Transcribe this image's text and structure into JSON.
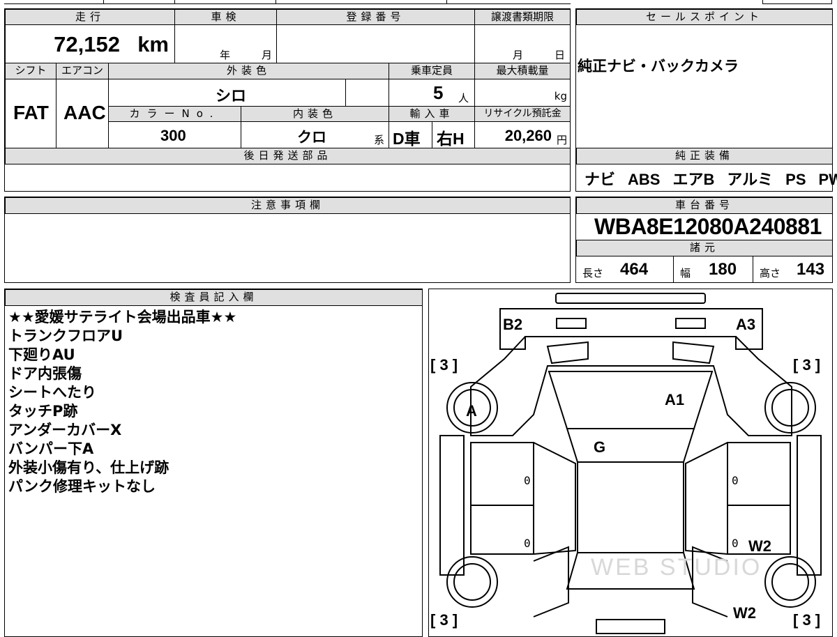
{
  "headers": {
    "mileage": "走行",
    "inspection": "車検",
    "registration": "登録番号",
    "transfer_deadline": "譲渡書類期限",
    "sales_point": "セールスポイント",
    "shift": "シフト",
    "aircon": "エアコン",
    "exterior_color": "外装色",
    "capacity": "乗車定員",
    "max_load": "最大積載量",
    "color_no": "カラーNo.",
    "interior_color": "内装色",
    "import": "輸入車",
    "recycle": "リサイクル預託金",
    "later_parts": "後日発送部品",
    "standard_equipment": "純正装備",
    "notes": "注意事項欄",
    "chassis_no": "車台番号",
    "specs": "諸元",
    "inspector": "検査員記入欄"
  },
  "vehicle": {
    "mileage": "72,152",
    "mileage_unit": "km",
    "year_unit": "年",
    "month_unit": "月",
    "deadline_month": "月",
    "deadline_day": "日",
    "shift": "FAT",
    "aircon": "AAC",
    "exterior_color": "シロ",
    "capacity": "5",
    "capacity_unit": "人",
    "load_unit": "kg",
    "color_no": "300",
    "interior_color": "クロ",
    "interior_suffix": "系",
    "import_type": "D車",
    "steering": "右H",
    "recycle_fee": "20,260",
    "yen_unit": "円",
    "chassis_no": "WBA8E12080A240881",
    "length_label": "長さ",
    "length": "464",
    "width_label": "幅",
    "width": "180",
    "height_label": "高さ",
    "height": "143"
  },
  "sales_point": "純正ナビ・バックカメラ",
  "equipment": [
    "ナビ",
    "ABS",
    "エアB",
    "アルミ",
    "PS",
    "PW"
  ],
  "inspector_notes": [
    "★★愛媛サテライト会場出品車★★",
    "トランクフロアU",
    "下廻りAU",
    "ドア内張傷",
    "シートへたり",
    "タッチP跡",
    "アンダーカバーX",
    "バンパー下A",
    "外装小傷有り、仕上げ跡",
    "パンク修理キットなし"
  ],
  "diagram": {
    "marks": {
      "b2": "B2",
      "a3": "A3",
      "a1": "A1",
      "a": "A",
      "g": "G",
      "w2_a": "W2",
      "w2_b": "W2",
      "zero_1": "0",
      "zero_2": "0",
      "zero_3": "0",
      "zero_4": "0"
    },
    "tread": {
      "tl": "[ 3 ]",
      "tr": "[ 3 ]",
      "bl": "[ 3 ]",
      "br": "[ 3 ]"
    },
    "watermark": "WEB STUDIO"
  }
}
